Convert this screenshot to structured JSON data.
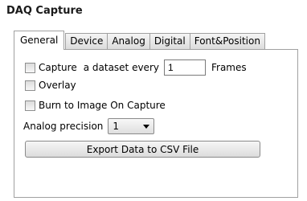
{
  "panel": {
    "title": "DAQ Capture"
  },
  "tabs": [
    {
      "label": "General",
      "active": true
    },
    {
      "label": "Device",
      "active": false
    },
    {
      "label": "Analog",
      "active": false
    },
    {
      "label": "Digital",
      "active": false
    },
    {
      "label": "Font&Position",
      "active": false
    }
  ],
  "general": {
    "capture_label": "Capture",
    "dataset_every_label": "a dataset every",
    "frames_value": "1",
    "frames_label": "Frames",
    "overlay_label": "Overlay",
    "burn_label": "Burn to Image On Capture",
    "precision_label": "Analog precision",
    "precision_value": "1",
    "export_label": "Export  Data to CSV File"
  }
}
